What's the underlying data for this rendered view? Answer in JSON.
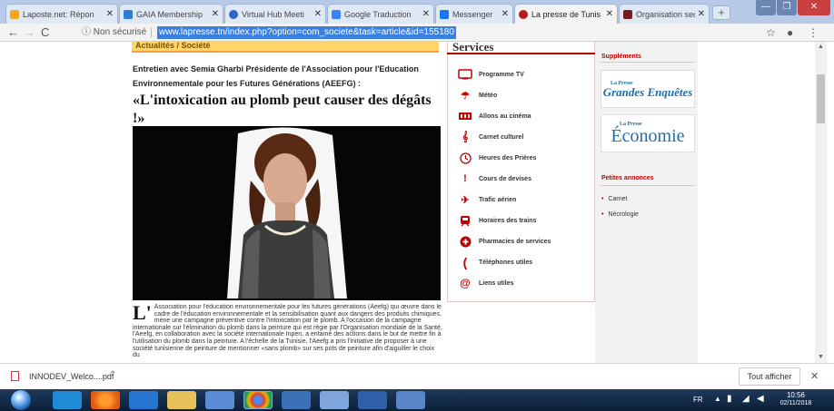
{
  "tabs": [
    {
      "label": "Laposte.net: Répon",
      "fav": "#f5a623",
      "icon": "laposte-icon"
    },
    {
      "label": "GAIA Membership",
      "fav": "#2f7bd8",
      "icon": "gaia-icon"
    },
    {
      "label": "Virtual Hub Meeti",
      "fav": "#2b67c9",
      "icon": "virtual-hub-icon"
    },
    {
      "label": "Google Traduction",
      "fav": "#3b82f6",
      "icon": "translate-icon"
    },
    {
      "label": "Messenger",
      "fav": "#1877f2",
      "icon": "facebook-icon"
    },
    {
      "label": "La presse de Tunis",
      "fav": "#b91c1c",
      "icon": "lapresse-icon"
    },
    {
      "label": "Organisation secr",
      "fav": "#7a1d1d",
      "icon": "organisation-icon"
    }
  ],
  "toolbar": {
    "security_label": "Non sécurisé",
    "url": "www.lapresse.tn/index.php?option=com_societe&task=article&id=155180"
  },
  "article": {
    "section_label": "Actualités / Société",
    "intro": "Entretien avec Semia Gharbi Présidente de l'Association pour l'Education Environnementale pour les Futures Générations (AEEFG) :",
    "headline": "«L'intoxication au plomb peut causer des dégâts !»",
    "dropcap": "L'",
    "body": "Association pour l'éducation environnementale pour les futures générations (Aeefg) qui œuvre dans le cadre de l'éducation environnementale et la sensibilisation quant aux dangers des produits chimiques, mène une campagne préventive contre l'intoxication par le plomb. A l'occasion de la campagne internationale sur l'élimination du plomb dans la peinture qui est régie par l'Organisation mondiale de la Santé, l'Aeefg, en collaboration avec la société internationale Inpen, a entamé des actions dans le but de mettre fin à l'utilisation du plomb dans la peinture. A l'échelle de la Tunisie, l'Aeefg a pris l'initiative de proposer à une société tunisienne de peinture de mentionner «sans plomb» sur ses pots de peinture afin d'aiguiller le choix du"
  },
  "services": {
    "title": "Services",
    "items": [
      {
        "label": "Programme TV",
        "icon": "tv-icon"
      },
      {
        "label": "Météo",
        "icon": "umbrella-icon"
      },
      {
        "label": "Allons au cinéma",
        "icon": "film-icon"
      },
      {
        "label": "Carnet culturel",
        "icon": "music-icon"
      },
      {
        "label": "Heures des Prières",
        "icon": "clock-icon"
      },
      {
        "label": "Cours de devises",
        "icon": "currency-icon"
      },
      {
        "label": "Trafic aérien",
        "icon": "plane-icon"
      },
      {
        "label": "Horaires des trains",
        "icon": "train-icon"
      },
      {
        "label": "Pharmacies de services",
        "icon": "pharmacy-icon"
      },
      {
        "label": "Téléphones utiles",
        "icon": "phone-icon"
      },
      {
        "label": "Liens utiles",
        "icon": "at-icon"
      }
    ]
  },
  "sidebar": {
    "supplements_title": "Suppléments",
    "supp1": "Grandes Enquêtes",
    "supp1_small": "La Presse",
    "supp2": "Économie",
    "supp2_small": "La Presse",
    "ads_title": "Petites annonces",
    "ads": [
      "Carnet",
      "Nécrologie"
    ]
  },
  "download": {
    "file": "INNODEV_Welco....pdf",
    "show_all": "Tout afficher"
  },
  "taskbar": {
    "lang": "FR",
    "time": "10:56",
    "date": "02/11/2018"
  }
}
